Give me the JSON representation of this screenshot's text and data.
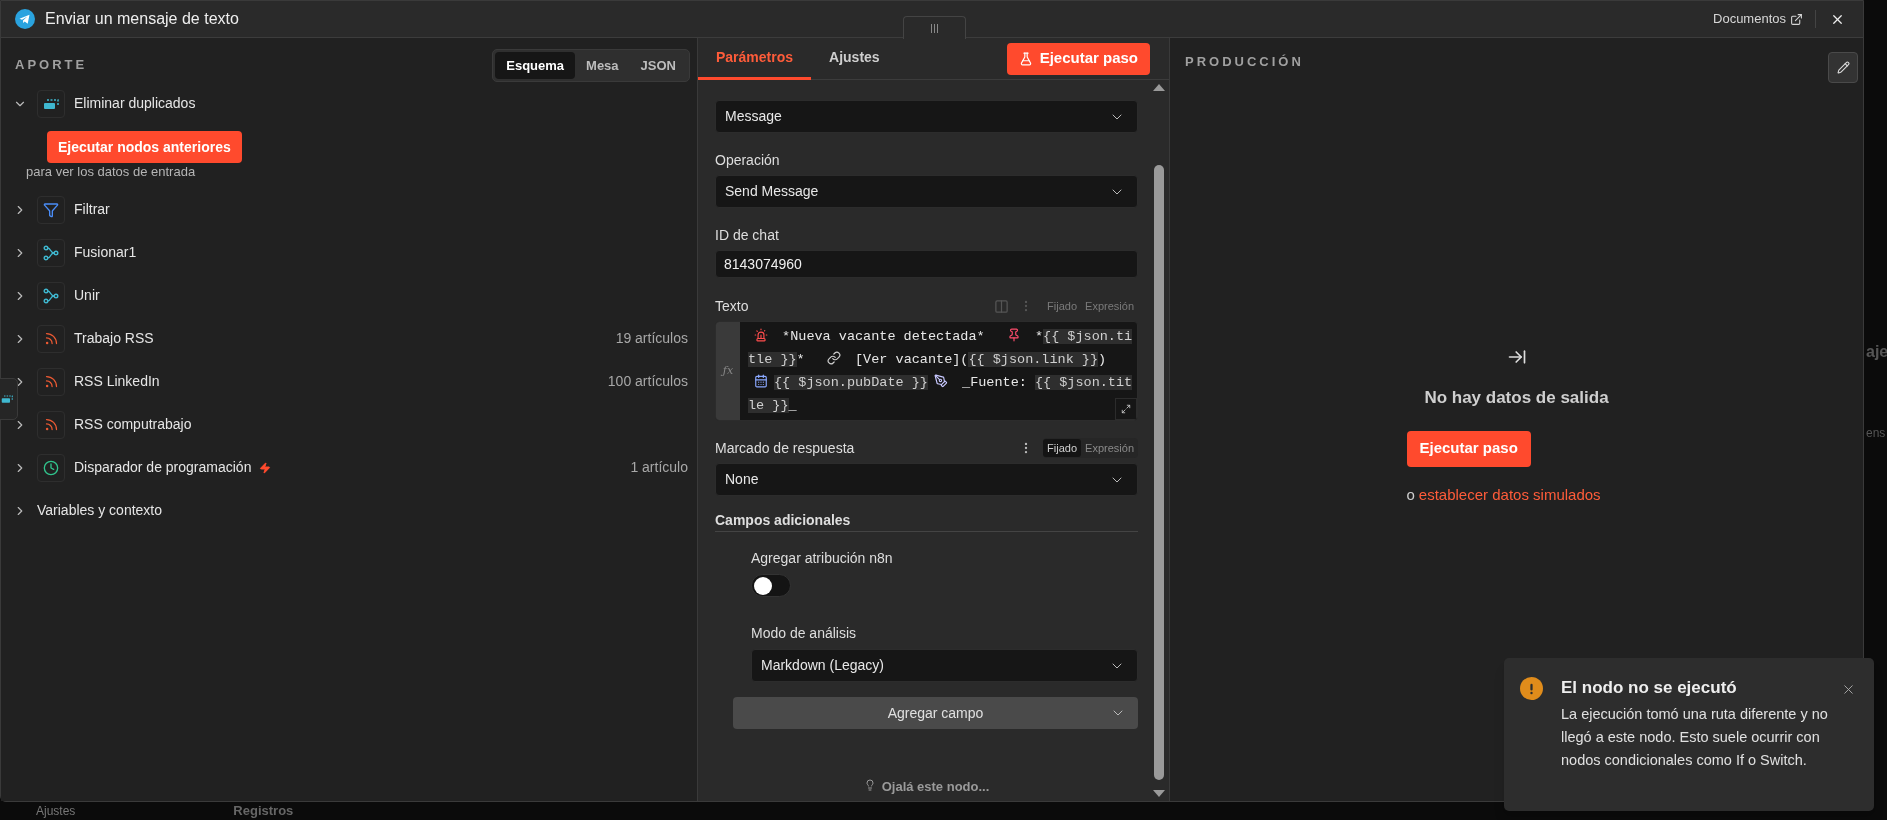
{
  "header": {
    "title": "Enviar un mensaje de texto",
    "docs_link": "Documentos"
  },
  "input_panel": {
    "title": "APORTE",
    "view_tabs": [
      {
        "label": "Esquema",
        "selected": true
      },
      {
        "label": "Mesa",
        "selected": false
      },
      {
        "label": "JSON",
        "selected": false
      }
    ],
    "run_button": "Ejecutar nodos anteriores",
    "run_hint": "para ver los datos de entrada",
    "nodes": [
      {
        "kind": "dedupe",
        "name": "Eliminar duplicados",
        "expanded": true,
        "trigger": false
      },
      {
        "kind": "filter",
        "name": "Filtrar",
        "expanded": false,
        "trigger": false
      },
      {
        "kind": "merge",
        "name": "Fusionar1",
        "expanded": false,
        "trigger": false
      },
      {
        "kind": "merge",
        "name": "Unir",
        "expanded": false,
        "trigger": false
      },
      {
        "kind": "rss",
        "name": "Trabajo RSS",
        "expanded": false,
        "trigger": false,
        "count": "19 artículos"
      },
      {
        "kind": "rss",
        "name": "RSS LinkedIn",
        "expanded": false,
        "trigger": false,
        "count": "100 artículos"
      },
      {
        "kind": "rss",
        "name": "RSS computrabajo",
        "expanded": false,
        "trigger": false
      },
      {
        "kind": "schedule",
        "name": "Disparador de programación",
        "expanded": false,
        "trigger": true,
        "count": "1 artículo"
      },
      {
        "kind": "variables",
        "name": "Variables y contexto",
        "expanded": false,
        "trigger": false
      }
    ]
  },
  "params_panel": {
    "tabs": [
      {
        "label": "Parámetros",
        "selected": true
      },
      {
        "label": "Ajustes",
        "selected": false
      }
    ],
    "run_button": "Ejecutar paso",
    "fields": [
      {
        "kind": "select",
        "value": "Message"
      },
      {
        "kind": "select",
        "label": "Operación",
        "value": "Send Message"
      },
      {
        "kind": "input",
        "label": "ID de chat",
        "value": "8143074960"
      },
      {
        "kind": "expression",
        "label": "Texto",
        "gutter_label": "ƒx",
        "mode": {
          "dimmed": true,
          "options": [
            {
              "label": "Fijado",
              "selected": false
            },
            {
              "label": "Expresión",
              "selected": false
            }
          ]
        },
        "segments": [
          {
            "kind": "siren"
          },
          {
            "kind": "text",
            "text": " *Nueva vacante detectada*  "
          },
          {
            "kind": "pin"
          },
          {
            "kind": "text",
            "text": " *"
          },
          {
            "kind": "expr",
            "text": "{{ $json.title }}"
          },
          {
            "kind": "text",
            "text": "*  "
          },
          {
            "kind": "link"
          },
          {
            "kind": "text",
            "text": " [Ver vacante]("
          },
          {
            "kind": "expr",
            "text": "{{ $json.link }}"
          },
          {
            "kind": "text",
            "text": ")\n"
          },
          {
            "kind": "calendar"
          },
          {
            "kind": "expr",
            "text": "{{ $json.pubDate }}"
          },
          {
            "kind": "pen"
          },
          {
            "kind": "text",
            "text": " _Fuente: "
          },
          {
            "kind": "expr",
            "text": "{{ $json.title }}"
          },
          {
            "kind": "text",
            "text": "_"
          }
        ]
      },
      {
        "kind": "select",
        "label": "Marcado de respuesta",
        "value": "None",
        "mode": {
          "dimmed": false,
          "options": [
            {
              "label": "Fijado",
              "selected": true
            },
            {
              "label": "Expresión",
              "selected": false
            }
          ]
        }
      }
    ],
    "additional": {
      "title": "Campos adicionales",
      "fields": [
        {
          "kind": "toggle",
          "label": "Agregar atribución n8n",
          "on": false
        },
        {
          "kind": "select",
          "label": "Modo de análisis",
          "value": "Markdown (Legacy)"
        }
      ],
      "add_button": "Agregar campo"
    },
    "hint": "Ojalá este nodo..."
  },
  "output_panel": {
    "title": "PRODUCCIÓN",
    "empty_title": "No hay datos de salida",
    "run_button": "Ejecutar paso",
    "hint_prefix": "o",
    "hint_link": "establecer datos simulados"
  },
  "toast": {
    "kind": "warning",
    "title": "El nodo no se ejecutó",
    "message": "La ejecución tomó una ruta diferente y no llegó a este nodo. Esto suele ocurrir con nodos condicionales como If o Switch."
  },
  "background": {
    "sidebar_item": "Ajustes",
    "bottom_tab": "Registros",
    "right_fragments": [
      "aje",
      "ens"
    ]
  }
}
